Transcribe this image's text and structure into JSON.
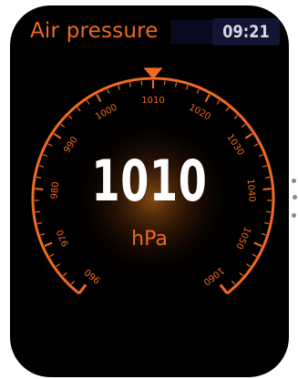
{
  "header": {
    "title": "Air pressure",
    "time": "09:21"
  },
  "gauge": {
    "value": 1010,
    "unit": "hPa",
    "min": 960,
    "max": 1060,
    "pointer_value": 1010,
    "tick_labels": [
      "960",
      "970",
      "980",
      "990",
      "1000",
      "1010",
      "1020",
      "1030",
      "1040",
      "1050",
      "1060"
    ],
    "accent_color": "#f06a1f"
  },
  "display": {
    "value_text": "1010",
    "unit_text": "hPa"
  }
}
